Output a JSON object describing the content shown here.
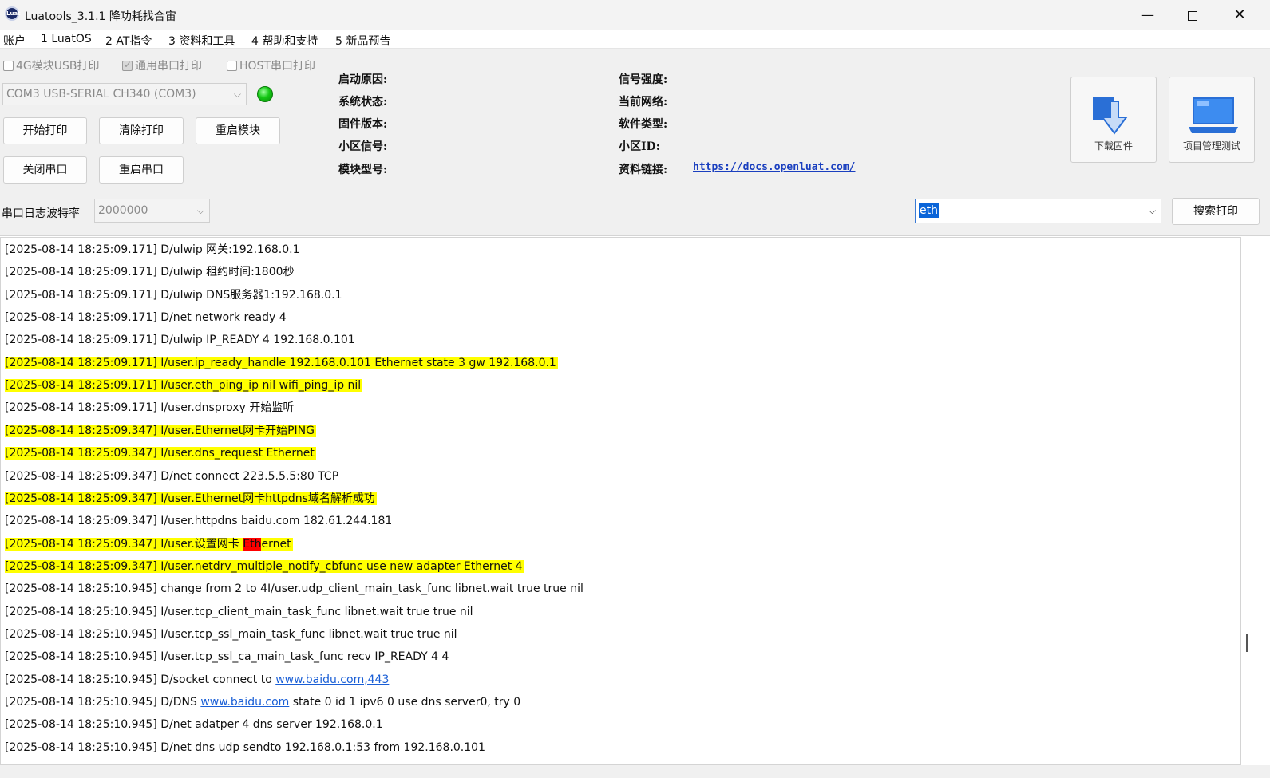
{
  "window": {
    "title": "Luatools_3.1.1 降功耗找合宙",
    "app_icon_text": "Luat",
    "minimize": "—",
    "close": "✕"
  },
  "menu": [
    "账户",
    "1 LuatOS",
    "2 AT指令",
    "3 资料和工具",
    "4 帮助和支持",
    "5 新品预告"
  ],
  "checkboxes": [
    {
      "label": "4G模块USB打印",
      "checked": false
    },
    {
      "label": "通用串口打印",
      "checked": true
    },
    {
      "label": "HOST串口打印",
      "checked": false
    }
  ],
  "port_select": {
    "value": "COM3 USB-SERIAL CH340 (COM3)"
  },
  "status_led": {
    "color": "#14c814"
  },
  "buttons": {
    "start_print": "开始打印",
    "clear_print": "清除打印",
    "restart_module": "重启模块",
    "close_port": "关闭串口",
    "restart_port": "重启串口",
    "download_firmware": "下载固件",
    "project_test": "项目管理测试",
    "search_print": "搜索打印"
  },
  "info": {
    "boot_reason": "启动原因:",
    "system_status": "系统状态:",
    "firmware_version": "固件版本:",
    "cell_signal": "小区信号:",
    "module_model": "模块型号:",
    "signal_strength": "信号强度:",
    "current_network": "当前网络:",
    "software_type": "软件类型:",
    "cell_id": "小区ID:",
    "docs_link_label": "资料链接:",
    "docs_link_url": "https://docs.openluat.com/"
  },
  "baud": {
    "label": "串口日志波特率",
    "value": "2000000"
  },
  "filter": {
    "value": "eth"
  },
  "highlight_color": "#ffff00",
  "match_color": "#ff0000",
  "log": [
    {
      "prefix": "[2025-08-14 18:25:09.171] D/ulwip 网关:192.168.0.1",
      "hl": false
    },
    {
      "prefix": "[2025-08-14 18:25:09.171] D/ulwip 租约时间:1800秒",
      "hl": false
    },
    {
      "prefix": "[2025-08-14 18:25:09.171] D/ulwip DNS服务器1:192.168.0.1",
      "hl": false
    },
    {
      "prefix": "[2025-08-14 18:25:09.171] D/net network ready 4",
      "hl": false
    },
    {
      "prefix": "[2025-08-14 18:25:09.171] D/ulwip IP_READY 4 192.168.0.101",
      "hl": false
    },
    {
      "prefix": "[2025-08-14 18:25:09.171] I/user.ip_ready_handle 192.168.0.101 Ethernet state 3 gw 192.168.0.1",
      "hl": true
    },
    {
      "prefix": "[2025-08-14 18:25:09.171] I/user.eth_ping_ip nil wifi_ping_ip nil",
      "hl": true
    },
    {
      "prefix": "[2025-08-14 18:25:09.171] I/user.dnsproxy 开始监听",
      "hl": false
    },
    {
      "prefix": "[2025-08-14 18:25:09.347] I/user.Ethernet网卡开始PING",
      "hl": true
    },
    {
      "prefix": "[2025-08-14 18:25:09.347] I/user.dns_request Ethernet",
      "hl": true
    },
    {
      "prefix": "[2025-08-14 18:25:09.347] D/net connect 223.5.5.5:80 TCP",
      "hl": false
    },
    {
      "prefix": "[2025-08-14 18:25:09.347] I/user.Ethernet网卡httpdns域名解析成功",
      "hl": true
    },
    {
      "prefix": "[2025-08-14 18:25:09.347] I/user.httpdns baidu.com 182.61.244.181",
      "hl": false
    },
    {
      "prefix": "[2025-08-14 18:25:09.347] I/user.设置网卡 ",
      "match": "Eth",
      "suffix": "ernet",
      "hl": true
    },
    {
      "prefix": "[2025-08-14 18:25:09.347] I/user.netdrv_multiple_notify_cbfunc use new adapter Ethernet 4",
      "hl": true
    },
    {
      "prefix": "[2025-08-14 18:25:10.945] change from 2 to 4I/user.udp_client_main_task_func libnet.wait true true nil",
      "hl": false
    },
    {
      "prefix": "[2025-08-14 18:25:10.945] I/user.tcp_client_main_task_func libnet.wait true true nil",
      "hl": false
    },
    {
      "prefix": "[2025-08-14 18:25:10.945] I/user.tcp_ssl_main_task_func libnet.wait true true nil",
      "hl": false
    },
    {
      "prefix": "[2025-08-14 18:25:10.945] I/user.tcp_ssl_ca_main_task_func recv IP_READY 4 4",
      "hl": false
    },
    {
      "prefix": "[2025-08-14 18:25:10.945] D/socket connect to ",
      "link": "www.baidu.com,443",
      "suffix": "",
      "hl": false
    },
    {
      "prefix": "[2025-08-14 18:25:10.945] D/DNS ",
      "link": "www.baidu.com",
      "suffix": " state 0 id 1 ipv6 0 use dns server0, try 0",
      "hl": false
    },
    {
      "prefix": "[2025-08-14 18:25:10.945] D/net adatper 4 dns server 192.168.0.1",
      "hl": false
    },
    {
      "prefix": "[2025-08-14 18:25:10.945] D/net dns udp sendto 192.168.0.1:53 from 192.168.0.101",
      "hl": false
    }
  ]
}
